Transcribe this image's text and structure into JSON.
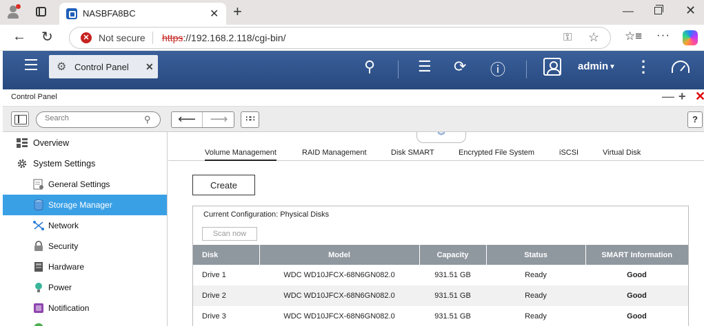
{
  "browser": {
    "tab_title": "NASBFA8BC",
    "not_secure_label": "Not secure",
    "url_scheme": "https",
    "url_rest": "://192.168.2.118/cgi-bin/"
  },
  "qnap_header": {
    "app_tab_label": "Control Panel",
    "user_label": "admin"
  },
  "window": {
    "title": "Control Panel",
    "search_placeholder": "Search"
  },
  "sidebar": {
    "items": [
      {
        "label": "Overview",
        "icon": "overview-icon",
        "level": "top"
      },
      {
        "label": "System Settings",
        "icon": "gear-icon",
        "level": "top"
      },
      {
        "label": "General Settings",
        "icon": "general-settings-icon",
        "level": "sub"
      },
      {
        "label": "Storage Manager",
        "icon": "storage-icon",
        "level": "sub",
        "active": true
      },
      {
        "label": "Network",
        "icon": "network-icon",
        "level": "sub"
      },
      {
        "label": "Security",
        "icon": "lock-icon",
        "level": "sub"
      },
      {
        "label": "Hardware",
        "icon": "hardware-icon",
        "level": "sub"
      },
      {
        "label": "Power",
        "icon": "power-bulb-icon",
        "level": "sub"
      },
      {
        "label": "Notification",
        "icon": "notification-icon",
        "level": "sub"
      }
    ]
  },
  "tabs": [
    {
      "label": "Volume Management",
      "active": true
    },
    {
      "label": "RAID Management"
    },
    {
      "label": "Disk SMART"
    },
    {
      "label": "Encrypted File System"
    },
    {
      "label": "iSCSI"
    },
    {
      "label": "Virtual Disk"
    }
  ],
  "main": {
    "create_label": "Create",
    "config_title": "Current Configuration: Physical Disks",
    "scan_label": "Scan now"
  },
  "disk_table": {
    "headers": [
      "Disk",
      "Model",
      "Capacity",
      "Status",
      "SMART Information"
    ],
    "rows": [
      [
        "Drive 1",
        "WDC WD10JFCX-68N6GN082.0",
        "931.51 GB",
        "Ready",
        "Good"
      ],
      [
        "Drive 2",
        "WDC WD10JFCX-68N6GN082.0",
        "931.51 GB",
        "Ready",
        "Good"
      ],
      [
        "Drive 3",
        "WDC WD10JFCX-68N6GN082.0",
        "931.51 GB",
        "Ready",
        "Good"
      ]
    ]
  },
  "colors": {
    "header_blue": "#27497f",
    "active_item": "#3aa0e6",
    "table_header": "#8f979f",
    "good_status": "#2f8a1e"
  }
}
